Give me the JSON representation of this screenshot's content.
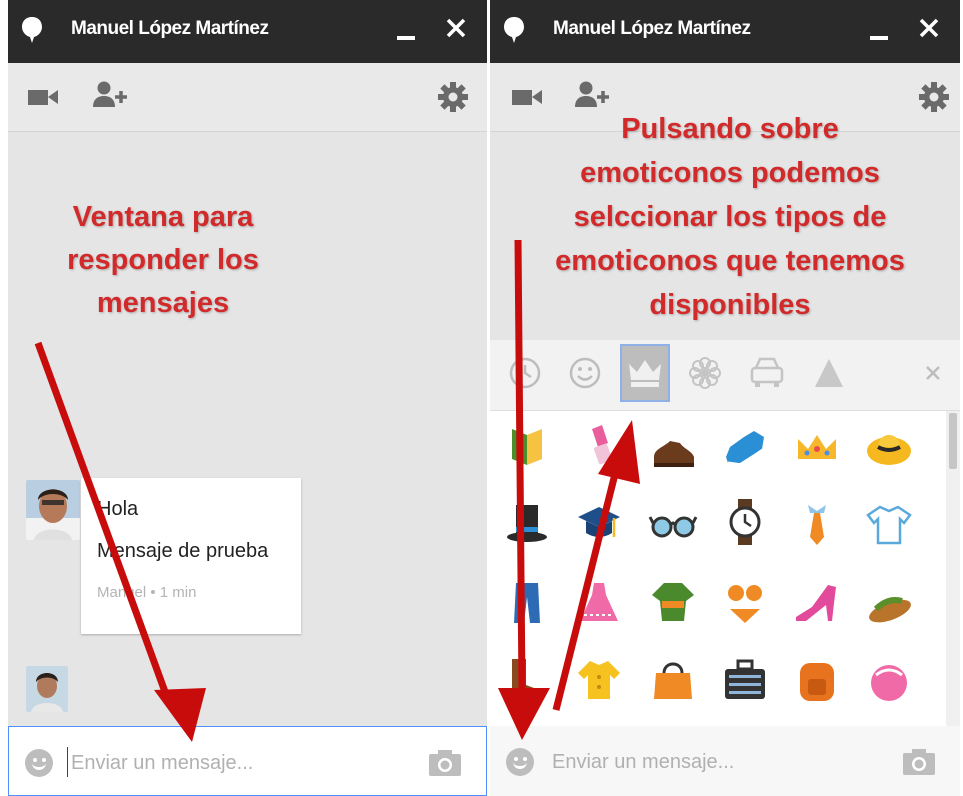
{
  "left_window": {
    "title": "Manuel López Martínez",
    "message": {
      "line1": "Hola",
      "line2": "Mensaje de prueba",
      "meta": "Manuel • 1 min"
    },
    "input_placeholder": "Enviar un mensaje..."
  },
  "right_window": {
    "title": "Manuel López Martínez",
    "input_placeholder": "Enviar un mensaje..."
  },
  "annotations": {
    "left": [
      "Ventana para",
      "responder los",
      "mensajes"
    ],
    "right": [
      "Pulsando sobre",
      "emoticonos podemos",
      "selccionar los tipos de",
      "emoticonos que tenemos",
      "disponibles"
    ]
  },
  "emoji_tabs": [
    "recent",
    "faces",
    "objects",
    "nature",
    "places",
    "symbols"
  ],
  "emoji_grid": [
    [
      "book",
      "lipstick",
      "shoe",
      "sneaker",
      "crown",
      "hat"
    ],
    [
      "top-hat",
      "graduation-cap",
      "glasses",
      "watch",
      "necktie",
      "t-shirt"
    ],
    [
      "jeans",
      "dress",
      "kimono",
      "bikini",
      "high-heel",
      "sandal"
    ],
    [
      "boots",
      "blouse",
      "handbag",
      "briefcase",
      "backpack",
      "purse"
    ]
  ],
  "colors": {
    "titlebar": "#2a2a2a",
    "panel": "#e5e5e5",
    "annotation": "#d22a2a",
    "arrow": "#c80c0c",
    "focus": "#4d90fe"
  }
}
